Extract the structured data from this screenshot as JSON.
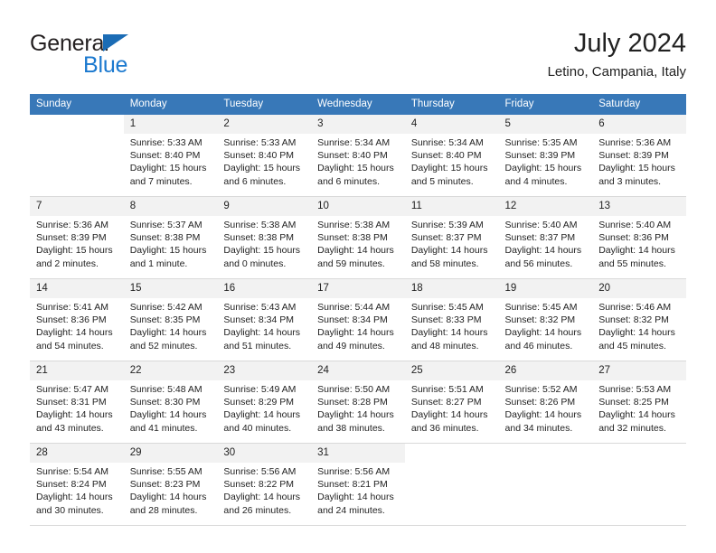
{
  "brand": {
    "word1": "General",
    "word2": "Blue",
    "triangle_color": "#1b6cb5",
    "blue_color": "#1b79cf"
  },
  "header": {
    "title": "July 2024",
    "subtitle": "Letino, Campania, Italy"
  },
  "theme": {
    "header_bg": "#3878b8",
    "header_text": "#ffffff",
    "daynum_bg": "#f2f2f2",
    "cell_bg": "#ffffff",
    "grid_line": "#d9d9d9"
  },
  "calendar": {
    "weekdays": [
      "Sunday",
      "Monday",
      "Tuesday",
      "Wednesday",
      "Thursday",
      "Friday",
      "Saturday"
    ],
    "weeks": [
      [
        {
          "day": "",
          "blank": true,
          "lines": []
        },
        {
          "day": "1",
          "lines": [
            "Sunrise: 5:33 AM",
            "Sunset: 8:40 PM",
            "Daylight: 15 hours",
            "and 7 minutes."
          ]
        },
        {
          "day": "2",
          "lines": [
            "Sunrise: 5:33 AM",
            "Sunset: 8:40 PM",
            "Daylight: 15 hours",
            "and 6 minutes."
          ]
        },
        {
          "day": "3",
          "lines": [
            "Sunrise: 5:34 AM",
            "Sunset: 8:40 PM",
            "Daylight: 15 hours",
            "and 6 minutes."
          ]
        },
        {
          "day": "4",
          "lines": [
            "Sunrise: 5:34 AM",
            "Sunset: 8:40 PM",
            "Daylight: 15 hours",
            "and 5 minutes."
          ]
        },
        {
          "day": "5",
          "lines": [
            "Sunrise: 5:35 AM",
            "Sunset: 8:39 PM",
            "Daylight: 15 hours",
            "and 4 minutes."
          ]
        },
        {
          "day": "6",
          "lines": [
            "Sunrise: 5:36 AM",
            "Sunset: 8:39 PM",
            "Daylight: 15 hours",
            "and 3 minutes."
          ]
        }
      ],
      [
        {
          "day": "7",
          "lines": [
            "Sunrise: 5:36 AM",
            "Sunset: 8:39 PM",
            "Daylight: 15 hours",
            "and 2 minutes."
          ]
        },
        {
          "day": "8",
          "lines": [
            "Sunrise: 5:37 AM",
            "Sunset: 8:38 PM",
            "Daylight: 15 hours",
            "and 1 minute."
          ]
        },
        {
          "day": "9",
          "lines": [
            "Sunrise: 5:38 AM",
            "Sunset: 8:38 PM",
            "Daylight: 15 hours",
            "and 0 minutes."
          ]
        },
        {
          "day": "10",
          "lines": [
            "Sunrise: 5:38 AM",
            "Sunset: 8:38 PM",
            "Daylight: 14 hours",
            "and 59 minutes."
          ]
        },
        {
          "day": "11",
          "lines": [
            "Sunrise: 5:39 AM",
            "Sunset: 8:37 PM",
            "Daylight: 14 hours",
            "and 58 minutes."
          ]
        },
        {
          "day": "12",
          "lines": [
            "Sunrise: 5:40 AM",
            "Sunset: 8:37 PM",
            "Daylight: 14 hours",
            "and 56 minutes."
          ]
        },
        {
          "day": "13",
          "lines": [
            "Sunrise: 5:40 AM",
            "Sunset: 8:36 PM",
            "Daylight: 14 hours",
            "and 55 minutes."
          ]
        }
      ],
      [
        {
          "day": "14",
          "lines": [
            "Sunrise: 5:41 AM",
            "Sunset: 8:36 PM",
            "Daylight: 14 hours",
            "and 54 minutes."
          ]
        },
        {
          "day": "15",
          "lines": [
            "Sunrise: 5:42 AM",
            "Sunset: 8:35 PM",
            "Daylight: 14 hours",
            "and 52 minutes."
          ]
        },
        {
          "day": "16",
          "lines": [
            "Sunrise: 5:43 AM",
            "Sunset: 8:34 PM",
            "Daylight: 14 hours",
            "and 51 minutes."
          ]
        },
        {
          "day": "17",
          "lines": [
            "Sunrise: 5:44 AM",
            "Sunset: 8:34 PM",
            "Daylight: 14 hours",
            "and 49 minutes."
          ]
        },
        {
          "day": "18",
          "lines": [
            "Sunrise: 5:45 AM",
            "Sunset: 8:33 PM",
            "Daylight: 14 hours",
            "and 48 minutes."
          ]
        },
        {
          "day": "19",
          "lines": [
            "Sunrise: 5:45 AM",
            "Sunset: 8:32 PM",
            "Daylight: 14 hours",
            "and 46 minutes."
          ]
        },
        {
          "day": "20",
          "lines": [
            "Sunrise: 5:46 AM",
            "Sunset: 8:32 PM",
            "Daylight: 14 hours",
            "and 45 minutes."
          ]
        }
      ],
      [
        {
          "day": "21",
          "lines": [
            "Sunrise: 5:47 AM",
            "Sunset: 8:31 PM",
            "Daylight: 14 hours",
            "and 43 minutes."
          ]
        },
        {
          "day": "22",
          "lines": [
            "Sunrise: 5:48 AM",
            "Sunset: 8:30 PM",
            "Daylight: 14 hours",
            "and 41 minutes."
          ]
        },
        {
          "day": "23",
          "lines": [
            "Sunrise: 5:49 AM",
            "Sunset: 8:29 PM",
            "Daylight: 14 hours",
            "and 40 minutes."
          ]
        },
        {
          "day": "24",
          "lines": [
            "Sunrise: 5:50 AM",
            "Sunset: 8:28 PM",
            "Daylight: 14 hours",
            "and 38 minutes."
          ]
        },
        {
          "day": "25",
          "lines": [
            "Sunrise: 5:51 AM",
            "Sunset: 8:27 PM",
            "Daylight: 14 hours",
            "and 36 minutes."
          ]
        },
        {
          "day": "26",
          "lines": [
            "Sunrise: 5:52 AM",
            "Sunset: 8:26 PM",
            "Daylight: 14 hours",
            "and 34 minutes."
          ]
        },
        {
          "day": "27",
          "lines": [
            "Sunrise: 5:53 AM",
            "Sunset: 8:25 PM",
            "Daylight: 14 hours",
            "and 32 minutes."
          ]
        }
      ],
      [
        {
          "day": "28",
          "lines": [
            "Sunrise: 5:54 AM",
            "Sunset: 8:24 PM",
            "Daylight: 14 hours",
            "and 30 minutes."
          ]
        },
        {
          "day": "29",
          "lines": [
            "Sunrise: 5:55 AM",
            "Sunset: 8:23 PM",
            "Daylight: 14 hours",
            "and 28 minutes."
          ]
        },
        {
          "day": "30",
          "lines": [
            "Sunrise: 5:56 AM",
            "Sunset: 8:22 PM",
            "Daylight: 14 hours",
            "and 26 minutes."
          ]
        },
        {
          "day": "31",
          "lines": [
            "Sunrise: 5:56 AM",
            "Sunset: 8:21 PM",
            "Daylight: 14 hours",
            "and 24 minutes."
          ]
        },
        {
          "day": "",
          "blank": true,
          "lines": []
        },
        {
          "day": "",
          "blank": true,
          "lines": []
        },
        {
          "day": "",
          "blank": true,
          "lines": []
        }
      ]
    ]
  }
}
